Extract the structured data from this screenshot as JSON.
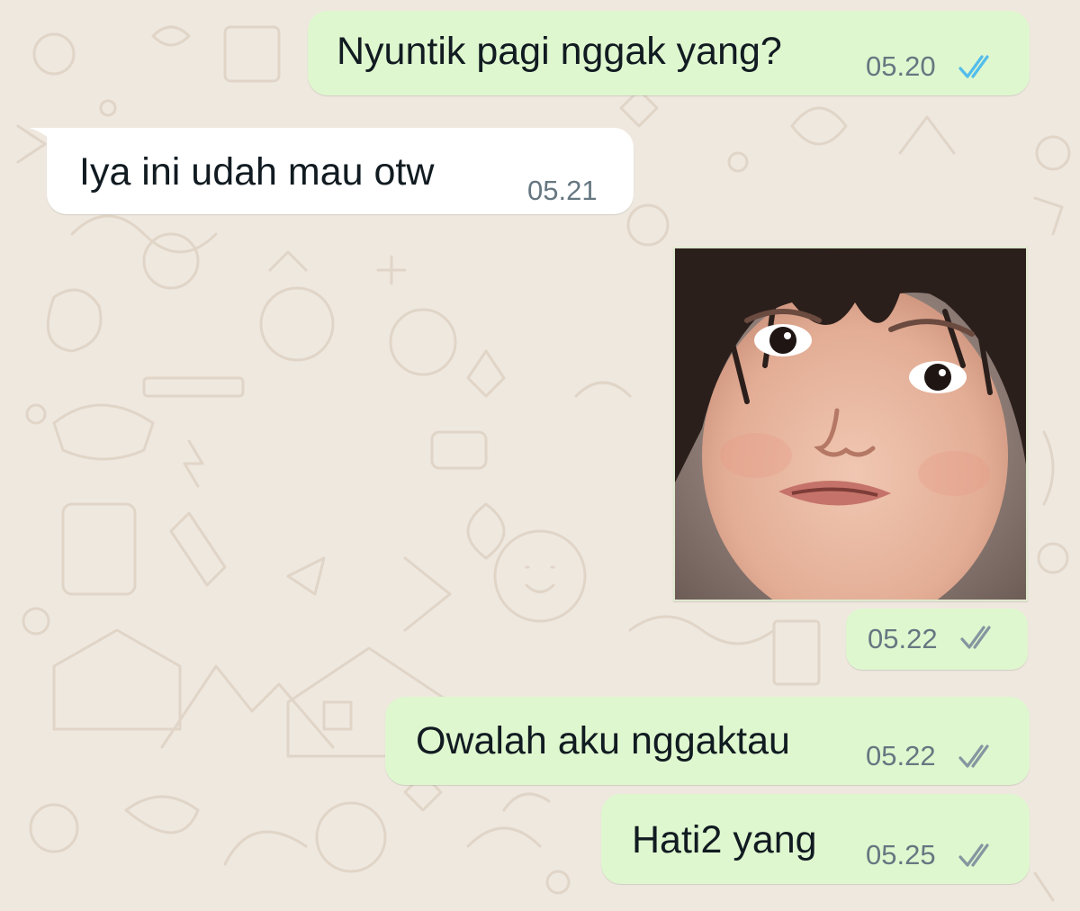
{
  "chat": {
    "messages": [
      {
        "direction": "outgoing",
        "text": "Nyuntik pagi nggak yang?",
        "time": "05.20",
        "status": "read",
        "status_icon": "double-check-icon"
      },
      {
        "direction": "incoming",
        "text": "Iya ini udah mau otw",
        "time": "05.21"
      },
      {
        "direction": "outgoing",
        "type": "image",
        "image": "sticker-child-face",
        "time": "05.22",
        "status": "delivered",
        "status_icon": "double-check-icon"
      },
      {
        "direction": "outgoing",
        "text": "Owalah aku nggaktau",
        "time": "05.22",
        "status": "delivered",
        "status_icon": "double-check-icon"
      },
      {
        "direction": "outgoing",
        "text": "Hati2 yang",
        "time": "05.25",
        "status": "delivered",
        "status_icon": "double-check-icon"
      }
    ]
  },
  "colors": {
    "wallpaper": "#efe8df",
    "outgoing_bubble": "#dff7cf",
    "incoming_bubble": "#ffffff",
    "read_ticks": "#53bdeb",
    "delivered_ticks": "#8696a0",
    "time_text": "#667781",
    "message_text": "#111b21"
  }
}
